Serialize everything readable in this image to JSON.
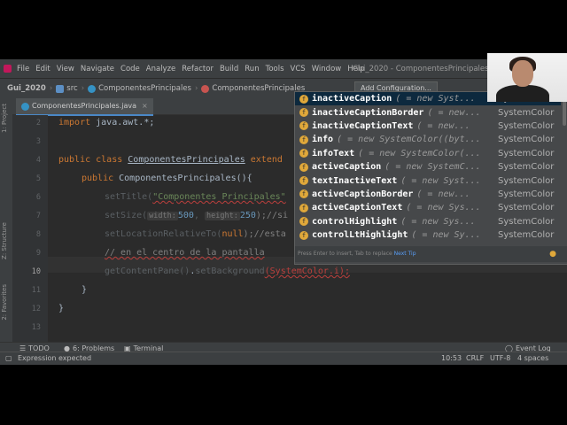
{
  "menu": {
    "items": [
      "File",
      "Edit",
      "View",
      "Navigate",
      "Code",
      "Analyze",
      "Refactor",
      "Build",
      "Run",
      "Tools",
      "VCS",
      "Window",
      "Help"
    ],
    "window_title": "Gui_2020 - ComponentesPrincipales.java"
  },
  "nav": {
    "project": "Gui_2020",
    "src": "src",
    "crumb1": "ComponentesPrincipales",
    "crumb2": "ComponentesPrincipales",
    "add_config": "Add Configuration..."
  },
  "editor_tab": {
    "label": "ComponentesPrincipales.java"
  },
  "side_labels": {
    "project": "1: Project",
    "structure": "Z: Structure",
    "favorites": "2: Favorites"
  },
  "line_numbers": [
    "2",
    "3",
    "4",
    "5",
    "6",
    "7",
    "8",
    "9",
    "10",
    "11",
    "12",
    "13"
  ],
  "code": {
    "l2_kw": "import",
    "l2_rest": " java.awt.*;",
    "l4_kw": "public class",
    "l4_name": "ComponentesPrincipales",
    "l4_ext": "extend",
    "l5_kw": "public",
    "l5_rest": " ComponentesPrincipales(){",
    "l6_pre": "setTitle(",
    "l6_str": "\"Componentes Principales\"",
    "l7_pre": "setSize(",
    "l7_hint_w": "width:",
    "l7_w": "500",
    "l7_hint_h": "height:",
    "l7_h": "250",
    "l7_post": ");//si",
    "l8_pre": "setLocationRelativeTo(",
    "l8_arg": "null",
    "l8_post": ");//esta",
    "l9_cmt": "// en el centro de la pantalla",
    "l10_pre": "getContentPane()",
    "l10_dot": ".",
    "l10_fn": "setBackground",
    "l10_arg": "(SystemColor.i);",
    "l11": "}",
    "l12": "}"
  },
  "completion": {
    "items": [
      {
        "name": "inactiveCaption",
        "sig": "( = new Syst...",
        "type": "SystemColor"
      },
      {
        "name": "inactiveCaptionBorder",
        "sig": "( = new...",
        "type": "SystemColor"
      },
      {
        "name": "inactiveCaptionText",
        "sig": "( = new...",
        "type": "SystemColor"
      },
      {
        "name": "info",
        "sig": "( = new SystemColor((byt...",
        "type": "SystemColor"
      },
      {
        "name": "infoText",
        "sig": "( = new SystemColor(...",
        "type": "SystemColor"
      },
      {
        "name": "activeCaption",
        "sig": "( = new SystemC...",
        "type": "SystemColor"
      },
      {
        "name": "textInactiveText",
        "sig": "( = new Syst...",
        "type": "SystemColor"
      },
      {
        "name": "activeCaptionBorder",
        "sig": "( = new...",
        "type": "SystemColor"
      },
      {
        "name": "activeCaptionText",
        "sig": "( = new Sys...",
        "type": "SystemColor"
      },
      {
        "name": "controlHighlight",
        "sig": "( = new Sys...",
        "type": "SystemColor"
      },
      {
        "name": "controlLtHighlight",
        "sig": "( = new Sy...",
        "type": "SystemColor"
      }
    ],
    "footer": "Press Enter to insert, Tab to replace",
    "footer_tip": "Next Tip"
  },
  "tool_windows": {
    "todo": "TODO",
    "problems": "6: Problems",
    "terminal": "Terminal",
    "event_log": "Event Log"
  },
  "status": {
    "message": "Expression expected",
    "position": "10:53",
    "line_sep": "CRLF",
    "encoding": "UTF-8",
    "indent": "4 spaces"
  },
  "colors": {
    "editor_bg": "#2b2b2b",
    "keyword": "#cc7832",
    "string": "#6a8759",
    "comment": "#808080",
    "selection": "#0d293e"
  }
}
